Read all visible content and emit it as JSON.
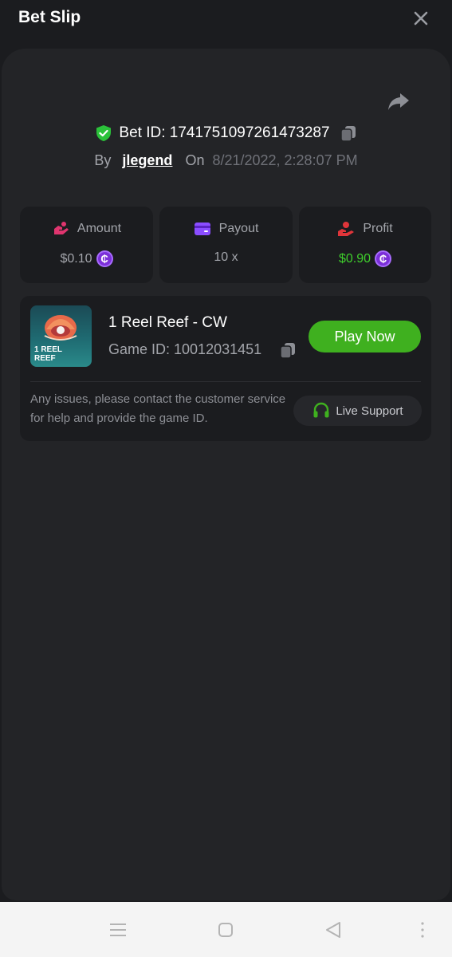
{
  "header": {
    "title": "Bet Slip",
    "close_icon": "close-icon"
  },
  "bet": {
    "id_label": "Bet ID: 1741751097261473287",
    "by_label": "By",
    "username": "jlegend",
    "on_label": "On",
    "datetime": "8/21/2022, 2:28:07 PM"
  },
  "stats": [
    {
      "label": "Amount",
      "value": "$0.10",
      "icon": "amount-icon",
      "icon_color": "#e0356f",
      "has_coin": true
    },
    {
      "label": "Payout",
      "value": "10 x",
      "icon": "wallet-icon",
      "icon_color": "#8a4dff",
      "has_coin": false
    },
    {
      "label": "Profit",
      "value": "$0.90",
      "icon": "profit-icon",
      "icon_color": "#e0353a",
      "has_coin": true
    }
  ],
  "coin_glyph": "₵",
  "game": {
    "title": "1 Reel Reef - CW",
    "game_id": "Game ID: 10012031451",
    "thumb_text": "1 REEL\nREEF",
    "play_label": "Play Now",
    "help_text": "Any issues, please contact the customer service for help and provide the game ID.",
    "support_label": "Live Support"
  },
  "colors": {
    "accent_green": "#3fb01f",
    "profit_green": "#3fcf2c",
    "coin_purple": "#7b2fd8",
    "background": "#1b1c1f",
    "panel": "#232427"
  }
}
